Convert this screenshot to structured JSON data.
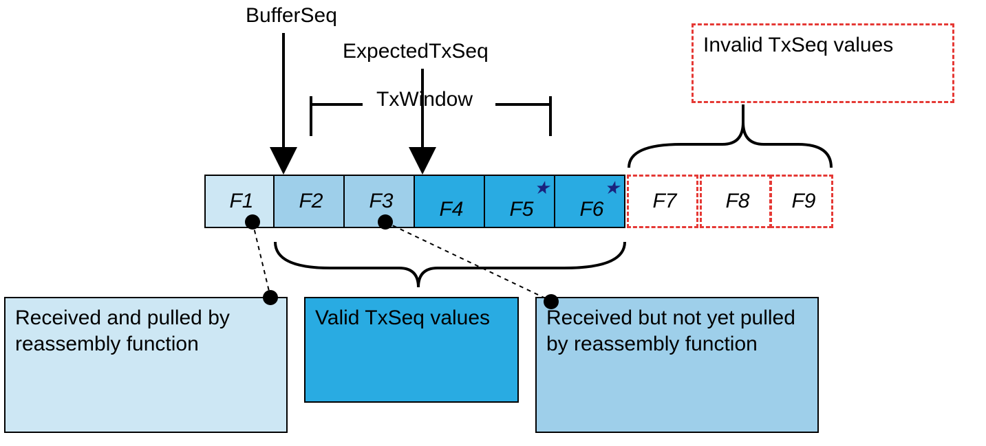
{
  "labels": {
    "bufferSeq": "BufferSeq",
    "expectedTxSeq": "ExpectedTxSeq",
    "txWindow": "TxWindow"
  },
  "frames": {
    "f1": "F1",
    "f2": "F2",
    "f3": "F3",
    "f4": "F4",
    "f5": "F5",
    "f6": "F6",
    "f7": "F7",
    "f8": "F8",
    "f9": "F9"
  },
  "callouts": {
    "pulled": "Received and pulled by reassembly function",
    "valid": "Valid TxSeq values",
    "notPulled": "Received but not yet pulled by reassembly function",
    "invalid": "Invalid TxSeq values"
  }
}
